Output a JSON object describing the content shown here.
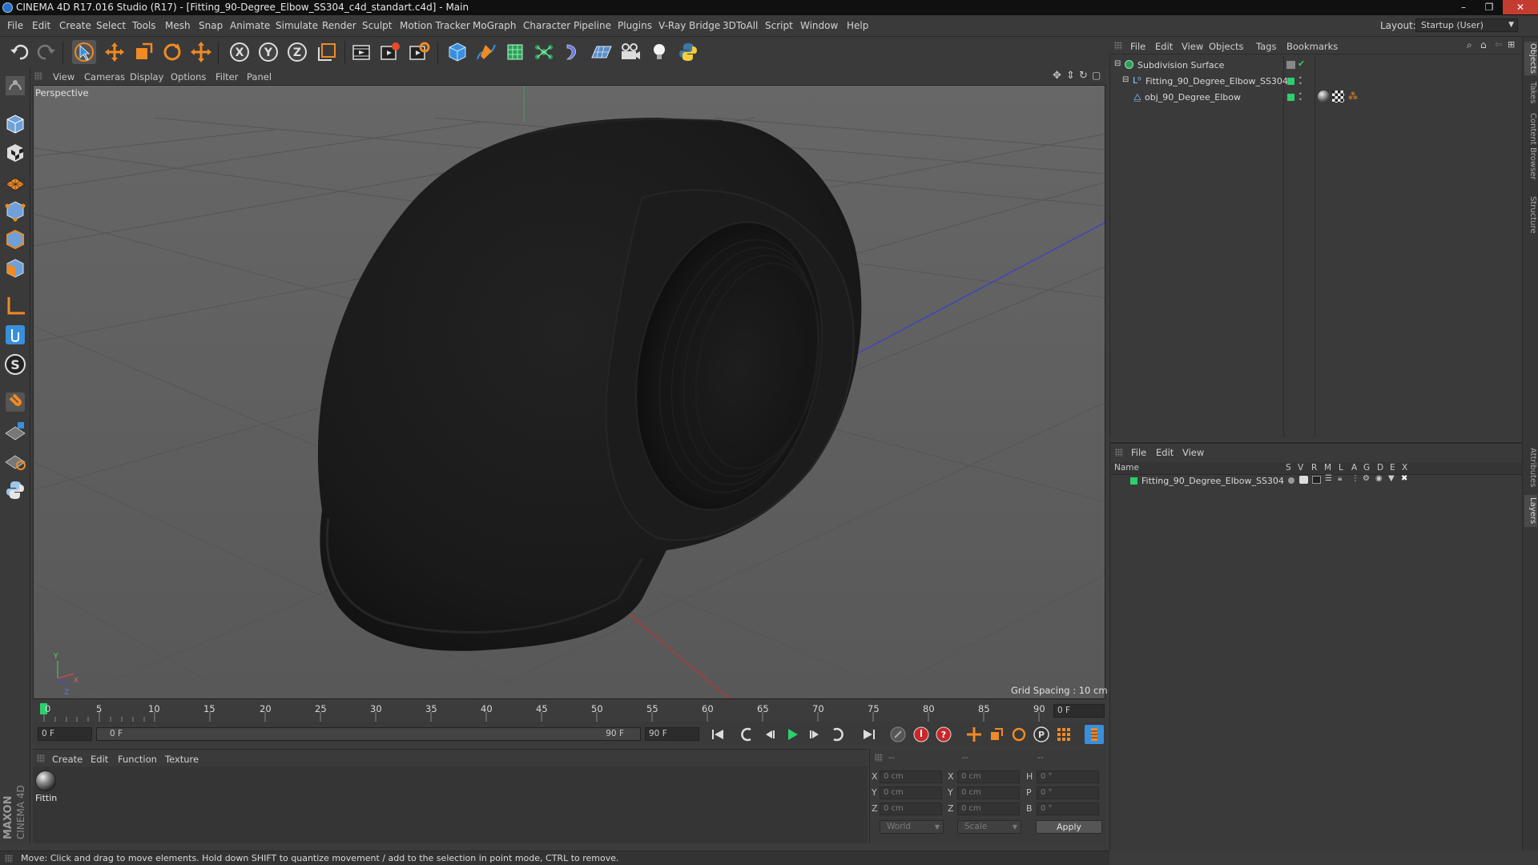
{
  "window": {
    "title": "CINEMA 4D R17.016 Studio (R17) - [Fitting_90-Degree_Elbow_SS304_c4d_standart.c4d] - Main",
    "controls": [
      "–",
      "❐",
      "✕"
    ]
  },
  "menubar": {
    "items": [
      "File",
      "Edit",
      "Create",
      "Select",
      "Tools",
      "Mesh",
      "Snap",
      "Animate",
      "Simulate",
      "Render",
      "Sculpt",
      "Motion Tracker",
      "MoGraph",
      "Character",
      "Pipeline",
      "Plugins",
      "V-Ray Bridge",
      "3DToAll",
      "Script",
      "Window",
      "Help"
    ],
    "layout_label": "Layout:",
    "layout_value": "Startup (User)"
  },
  "toolbar": {
    "icons": [
      "undo-icon",
      "redo-icon",
      "select-cursor-icon",
      "move-icon",
      "scale-icon",
      "rotate-icon",
      "live-select-icon",
      "x-axis-icon",
      "y-axis-icon",
      "z-axis-icon",
      "coordinate-system-icon",
      "render-view-icon",
      "render-picture-viewer-icon",
      "render-settings-icon",
      "cube-icon",
      "spline-pen-icon",
      "subdivision-icon",
      "cloner-icon",
      "deformer-icon",
      "floor-icon",
      "camera-icon",
      "light-icon",
      "python-icon"
    ],
    "axis_labels": {
      "x": "X",
      "y": "Y",
      "z": "Z"
    }
  },
  "viewport": {
    "menu": [
      "View",
      "Cameras",
      "Display",
      "Options",
      "Filter",
      "Panel"
    ],
    "label": "Perspective",
    "grid_spacing": "Grid Spacing : 10 cm"
  },
  "timeline": {
    "ticks": [
      "0",
      "5",
      "10",
      "15",
      "20",
      "25",
      "30",
      "35",
      "40",
      "45",
      "50",
      "55",
      "60",
      "65",
      "70",
      "75",
      "80",
      "85",
      "90"
    ],
    "current_frame": "0 F",
    "start_field": "0 F",
    "range_start": "0 F",
    "range_end": "90 F",
    "end_field": "90 F"
  },
  "material_manager": {
    "menu": [
      "Create",
      "Edit",
      "Function",
      "Texture"
    ],
    "materials": [
      {
        "name": "Fittin"
      }
    ]
  },
  "coordinates": {
    "header": [
      "--",
      "--",
      "--"
    ],
    "rows": [
      {
        "pos_label": "X",
        "pos": "0 cm",
        "size_label": "X",
        "size": "0 cm",
        "rot_label": "H",
        "rot": "0 °"
      },
      {
        "pos_label": "Y",
        "pos": "0 cm",
        "size_label": "Y",
        "size": "0 cm",
        "rot_label": "P",
        "rot": "0 °"
      },
      {
        "pos_label": "Z",
        "pos": "0 cm",
        "size_label": "Z",
        "size": "0 cm",
        "rot_label": "B",
        "rot": "0 °"
      }
    ],
    "mode_world": "World",
    "mode_scale": "Scale",
    "apply": "Apply"
  },
  "object_manager": {
    "menu": [
      "File",
      "Edit",
      "View",
      "Objects",
      "Tags",
      "Bookmarks"
    ],
    "objects": [
      {
        "name": "Subdivision Surface",
        "indent": 0
      },
      {
        "name": "Fitting_90_Degree_Elbow_SS304",
        "indent": 1
      },
      {
        "name": "obj_90_Degree_Elbow",
        "indent": 2
      }
    ]
  },
  "layer_manager": {
    "menu": [
      "File",
      "Edit",
      "View"
    ],
    "columns": [
      "Name",
      "S",
      "V",
      "R",
      "M",
      "L",
      "A",
      "G",
      "D",
      "E",
      "X"
    ],
    "layers": [
      {
        "name": "Fitting_90_Degree_Elbow_SS304",
        "color": "#2ccf6c"
      }
    ]
  },
  "right_tabs": [
    "Objects",
    "Takes",
    "Content Browser",
    "Structure",
    "Attributes",
    "Layers"
  ],
  "status": {
    "text": "Move: Click and drag to move elements. Hold down SHIFT to quantize movement / add to the selection in point mode, CTRL to remove."
  },
  "branding": {
    "logo_text": "MAXON CINEMA 4D"
  },
  "colors": {
    "accent_blue": "#3a8fdc",
    "layer_green": "#2ccf6c",
    "viewport_bg": "#5c5c5c",
    "title_bar": "#101010"
  }
}
